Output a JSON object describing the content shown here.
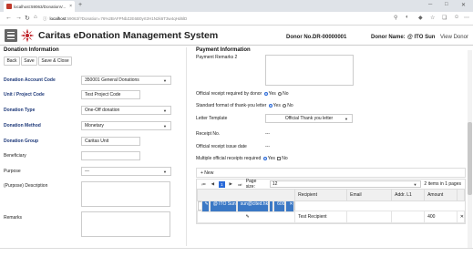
{
  "browser": {
    "tab_title": "localhost:59063/DonationV...",
    "tab_close": "×",
    "new_tab": "+",
    "url_host": "localhost",
    "url_path": ":59063/?Donation=76%2BAFPNbZJE6B0yrI2H1N2k6T3w4qHd6lD",
    "min": "─",
    "max": "□",
    "close": "✕"
  },
  "header": {
    "title": "Caritas eDonation Management System",
    "donor_no_label": "Donor No.:",
    "donor_no_value": "DR-00000001",
    "donor_name_label": "Donor Name:",
    "donor_name_value": "@ ITO Sun",
    "view_donor": "View Donor"
  },
  "donation": {
    "section_title": "Donation Information",
    "buttons": {
      "back": "Back",
      "save": "Save",
      "save_close": "Save & Close"
    },
    "account_code_label": "Donation Account Code",
    "account_code_value": "350001 General Donations",
    "project_code_label": "Unit / Project Code",
    "project_code_value": "Test Project Code",
    "type_label": "Donation Type",
    "type_value": "One-Off donation",
    "method_label": "Donation Method",
    "method_value": "Monetary",
    "group_label": "Donation Group",
    "group_value": "Caritas Unit",
    "beneficiary_label": "Beneficiary",
    "purpose_label": "Purpose",
    "purpose_value": "---",
    "purpose_desc_label": "(Purpose) Description",
    "remarks_label": "Remarks"
  },
  "payment": {
    "section_title": "Payment Information",
    "remarks2_label": "Payment Remarks 2",
    "official_receipt_label": "Official receipt required by donor",
    "standard_format_label": "Standard format of thank-you letter",
    "yes": "Yes",
    "no": "No",
    "letter_template_label": "Letter Template",
    "letter_template_value": "Official Thank you letter",
    "receipt_no_label": "Receipt No.",
    "receipt_no_value": "---",
    "issue_date_label": "Official receipt issue date",
    "issue_date_value": "---",
    "multiple_label": "Multiple official receipts required"
  },
  "grid": {
    "new_label": "+ New",
    "page_current": "1",
    "page_size_label": "Page size:",
    "page_size_value": "12",
    "items_label": "2 items in 1 pages",
    "columns": [
      "Recipient",
      "Email",
      "Addr. L1",
      "Amount"
    ],
    "rows": [
      {
        "recipient": "@ ITO Sun",
        "email": "sun@cited.hk",
        "addr": "",
        "amount": "600"
      },
      {
        "recipient": "Test Recipient",
        "email": "",
        "addr": "",
        "amount": "400"
      }
    ]
  }
}
